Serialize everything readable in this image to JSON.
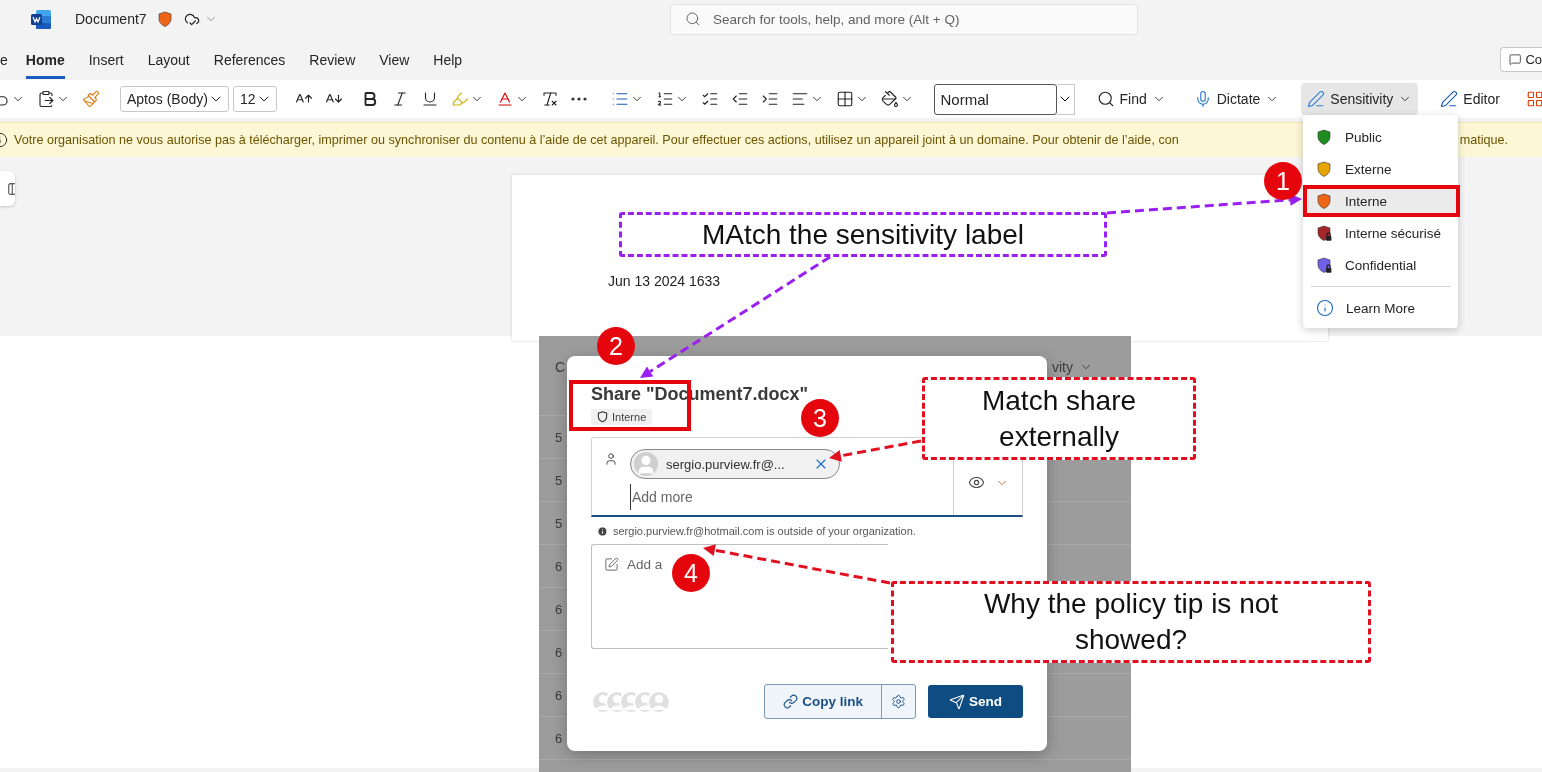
{
  "title_bar": {
    "document_name": "Document7",
    "search": {
      "placeholder": "Search for tools, help, and more (Alt + Q)"
    }
  },
  "tabs": [
    {
      "label": "e",
      "selected": false
    },
    {
      "label": "Home",
      "selected": true
    },
    {
      "label": "Insert",
      "selected": false
    },
    {
      "label": "Layout",
      "selected": false
    },
    {
      "label": "References",
      "selected": false
    },
    {
      "label": "Review",
      "selected": false
    },
    {
      "label": "View",
      "selected": false
    },
    {
      "label": "Help",
      "selected": false
    }
  ],
  "comments_button": {
    "label": "Co"
  },
  "ribbon": {
    "font": "Aptos (Body)",
    "font_size": "12",
    "style": "Normal",
    "find": "Find",
    "dictate": "Dictate",
    "sensitivity": {
      "label": "Sensitivity",
      "expanded": true
    },
    "editor": "Editor"
  },
  "message_bar": {
    "text": "Votre organisation ne vous autorise pas à télécharger, imprimer ou synchroniser du contenu à l’aide de cet appareil. Pour effectuer ces actions, utilisez un appareil joint à un domaine. Pour obtenir de l’aide, con",
    "text_end": "matique."
  },
  "sensitivity_menu": {
    "items": [
      {
        "label": "Public",
        "color": "#1e8c1e",
        "locked": false,
        "selected": false
      },
      {
        "label": "Externe",
        "color": "#e8a400",
        "locked": false,
        "selected": false
      },
      {
        "label": "Interne",
        "color": "#f06418",
        "locked": false,
        "selected": true
      },
      {
        "label": "Interne sécurisé",
        "color": "#a4262c",
        "locked": true,
        "selected": false
      },
      {
        "label": "Confidential",
        "color": "#7160e8",
        "locked": true,
        "selected": false
      }
    ],
    "learn_more": "Learn More"
  },
  "document": {
    "text": "Jun 13 2024 1633"
  },
  "background_list": {
    "columns": [
      "C",
      "vity"
    ],
    "rows": [
      "5",
      "5",
      "5",
      "6",
      "6",
      "6",
      "6",
      "6"
    ]
  },
  "share_dialog": {
    "title": "Share \"Document7.docx\"",
    "label": "Interne",
    "recipient": "sergio.purview.fr@...",
    "add_more": {
      "placeholder": "Add more"
    },
    "external_notice": "sergio.purview.fr@hotmail.com is outside of your organization.",
    "message": {
      "placeholder": "Add a"
    },
    "copy_link": "Copy link",
    "send": "Send"
  },
  "annotations": {
    "callouts": [
      {
        "text": "MAtch the sensitivity label",
        "color": "#9a1ff0"
      },
      {
        "text": "Match share externally",
        "color": "#e01020"
      },
      {
        "text": "Why the policy tip is not showed?",
        "color": "#e01020"
      }
    ],
    "markers": [
      "1",
      "2",
      "3",
      "4"
    ]
  }
}
